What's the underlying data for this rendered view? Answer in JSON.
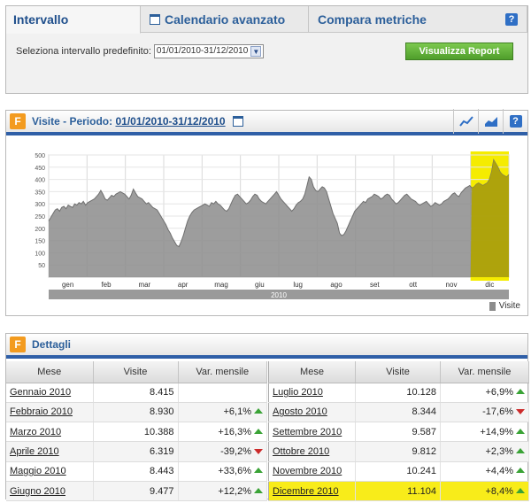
{
  "tabs": [
    {
      "label": "Intervallo",
      "active": true
    },
    {
      "label": "Calendario avanzato",
      "active": false
    },
    {
      "label": "Compara metriche",
      "active": false
    }
  ],
  "help_label": "?",
  "range": {
    "label": "Seleziona intervallo predefinito:",
    "value": "01/01/2010-31/12/2010"
  },
  "report_button": "Visualizza Report",
  "chart_panel": {
    "title_prefix": "Visite - Periodo:",
    "title_period": "01/01/2010-31/12/2010",
    "logo_letter": "F"
  },
  "chart_data": {
    "type": "area",
    "y_ticks": [
      50,
      100,
      150,
      200,
      250,
      300,
      350,
      400,
      450,
      500
    ],
    "ylim": [
      0,
      500
    ],
    "month_labels": [
      "gen",
      "feb",
      "mar",
      "apr",
      "mag",
      "giu",
      "lug",
      "ago",
      "set",
      "ott",
      "nov",
      "dic"
    ],
    "year_label": "2010",
    "highlight_month": "dic",
    "series_color": "#8c8c8c",
    "highlight_color": "#f5ec00",
    "series": [
      {
        "name": "Visite",
        "values": [
          230,
          245,
          260,
          275,
          280,
          270,
          285,
          290,
          280,
          295,
          290,
          285,
          300,
          295,
          305,
          300,
          310,
          295,
          305,
          310,
          315,
          320,
          330,
          340,
          355,
          340,
          320,
          315,
          325,
          335,
          330,
          340,
          345,
          350,
          345,
          340,
          330,
          320,
          335,
          360,
          345,
          330,
          325,
          320,
          310,
          300,
          305,
          295,
          285,
          280,
          275,
          260,
          245,
          230,
          215,
          195,
          180,
          160,
          145,
          130,
          125,
          145,
          170,
          200,
          230,
          250,
          265,
          275,
          280,
          285,
          290,
          295,
          300,
          295,
          290,
          305,
          300,
          310,
          300,
          295,
          285,
          275,
          270,
          280,
          300,
          320,
          335,
          340,
          330,
          320,
          310,
          300,
          305,
          315,
          330,
          340,
          335,
          320,
          310,
          305,
          300,
          310,
          320,
          330,
          340,
          350,
          335,
          320,
          310,
          300,
          290,
          280,
          270,
          280,
          295,
          305,
          310,
          320,
          340,
          375,
          410,
          400,
          370,
          355,
          350,
          360,
          370,
          365,
          350,
          320,
          290,
          260,
          240,
          220,
          180,
          170,
          175,
          190,
          210,
          230,
          250,
          270,
          280,
          290,
          300,
          310,
          305,
          320,
          325,
          330,
          340,
          335,
          330,
          320,
          325,
          335,
          340,
          335,
          320,
          310,
          300,
          305,
          315,
          325,
          335,
          340,
          330,
          320,
          315,
          310,
          300,
          295,
          300,
          305,
          310,
          300,
          290,
          295,
          305,
          300,
          295,
          300,
          310,
          315,
          320,
          330,
          340,
          345,
          335,
          330,
          345,
          355,
          365,
          370,
          375,
          365,
          370,
          380,
          385,
          380,
          375,
          380,
          385,
          400,
          430,
          480,
          465,
          450,
          430,
          420,
          415,
          410,
          420
        ]
      }
    ]
  },
  "details_panel": {
    "title": "Dettagli",
    "logo_letter": "F",
    "headers": [
      "Mese",
      "Visite",
      "Var. mensile"
    ],
    "left_rows": [
      {
        "mese": "Gennaio 2010",
        "visite": "8.415",
        "var": "",
        "trend": ""
      },
      {
        "mese": "Febbraio 2010",
        "visite": "8.930",
        "var": "+6,1%",
        "trend": "up"
      },
      {
        "mese": "Marzo 2010",
        "visite": "10.388",
        "var": "+16,3%",
        "trend": "up"
      },
      {
        "mese": "Aprile 2010",
        "visite": "6.319",
        "var": "-39,2%",
        "trend": "down"
      },
      {
        "mese": "Maggio 2010",
        "visite": "8.443",
        "var": "+33,6%",
        "trend": "up"
      },
      {
        "mese": "Giugno 2010",
        "visite": "9.477",
        "var": "+12,2%",
        "trend": "up"
      }
    ],
    "right_rows": [
      {
        "mese": "Luglio 2010",
        "visite": "10.128",
        "var": "+6,9%",
        "trend": "up"
      },
      {
        "mese": "Agosto 2010",
        "visite": "8.344",
        "var": "-17,6%",
        "trend": "down"
      },
      {
        "mese": "Settembre 2010",
        "visite": "9.587",
        "var": "+14,9%",
        "trend": "up"
      },
      {
        "mese": "Ottobre 2010",
        "visite": "9.812",
        "var": "+2,3%",
        "trend": "up"
      },
      {
        "mese": "Novembre 2010",
        "visite": "10.241",
        "var": "+4,4%",
        "trend": "up"
      },
      {
        "mese": "Dicembre 2010",
        "visite": "11.104",
        "var": "+8,4%",
        "trend": "up",
        "highlight": true
      }
    ]
  }
}
